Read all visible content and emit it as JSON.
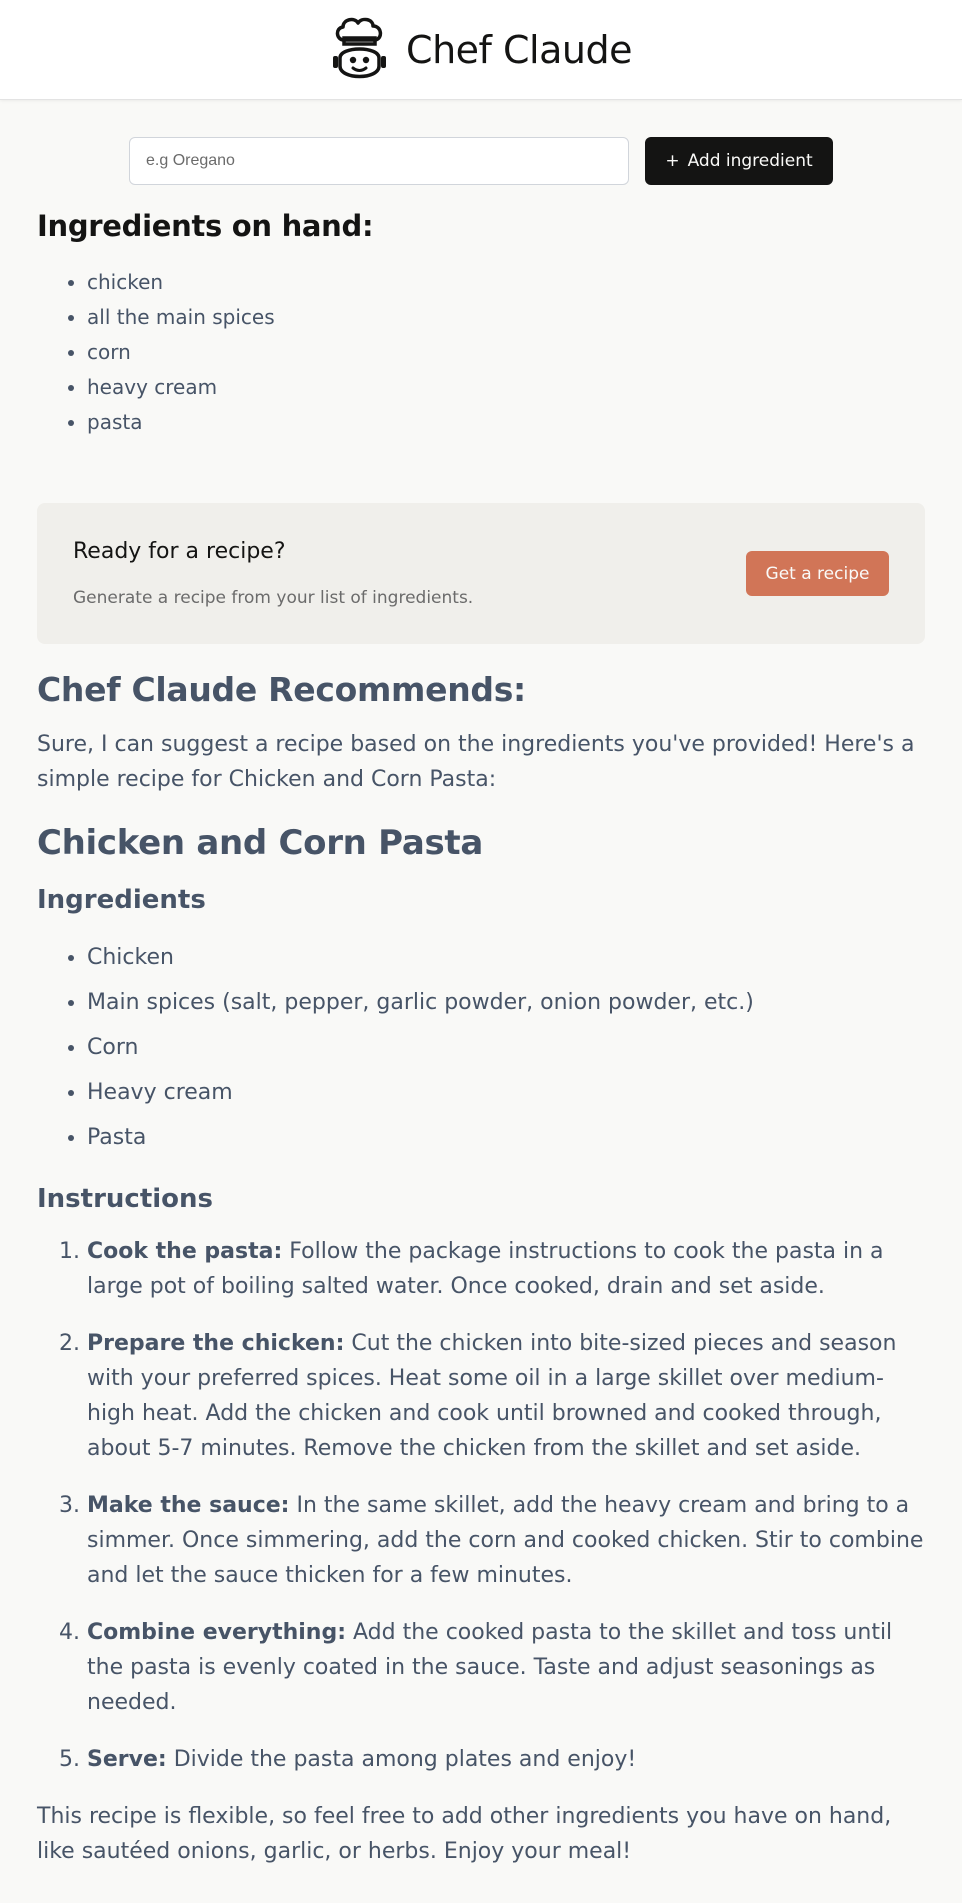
{
  "header": {
    "title": "Chef Claude",
    "logo_icon": "chef-robot-icon"
  },
  "add_form": {
    "placeholder": "e.g Oregano",
    "value": "",
    "button_label": "Add ingredient",
    "button_icon": "plus-icon"
  },
  "onhand": {
    "title": "Ingredients on hand:",
    "items": [
      "chicken",
      "all the main spices",
      "corn",
      "heavy cream",
      "pasta"
    ]
  },
  "cta": {
    "title": "Ready for a recipe?",
    "description": "Generate a recipe from your list of ingredients.",
    "button_label": "Get a recipe"
  },
  "recipe": {
    "heading": "Chef Claude Recommends:",
    "intro": "Sure, I can suggest a recipe based on the ingredients you've provided! Here's a simple recipe for Chicken and Corn Pasta:",
    "title": "Chicken and Corn Pasta",
    "ingredients_title": "Ingredients",
    "ingredients": [
      "Chicken",
      "Main spices (salt, pepper, garlic powder, onion powder, etc.)",
      "Corn",
      "Heavy cream",
      "Pasta"
    ],
    "instructions_title": "Instructions",
    "instructions": [
      {
        "label": "Cook the pasta:",
        "text": "Follow the package instructions to cook the pasta in a large pot of boiling salted water. Once cooked, drain and set aside."
      },
      {
        "label": "Prepare the chicken:",
        "text": "Cut the chicken into bite-sized pieces and season with your preferred spices. Heat some oil in a large skillet over medium-high heat. Add the chicken and cook until browned and cooked through, about 5-7 minutes. Remove the chicken from the skillet and set aside."
      },
      {
        "label": "Make the sauce:",
        "text": "In the same skillet, add the heavy cream and bring to a simmer. Once simmering, add the corn and cooked chicken. Stir to combine and let the sauce thicken for a few minutes."
      },
      {
        "label": "Combine everything:",
        "text": "Add the cooked pasta to the skillet and toss until the pasta is evenly coated in the sauce. Taste and adjust seasonings as needed."
      },
      {
        "label": "Serve:",
        "text": "Divide the pasta among plates and enjoy!"
      }
    ],
    "outro": "This recipe is flexible, so feel free to add other ingredients you have on hand, like sautéed onions, garlic, or herbs. Enjoy your meal!"
  },
  "colors": {
    "accent": "#d17557",
    "dark": "#141413",
    "text": "#475467",
    "background": "#f9f9f7",
    "cta_background": "#f0efeb"
  }
}
